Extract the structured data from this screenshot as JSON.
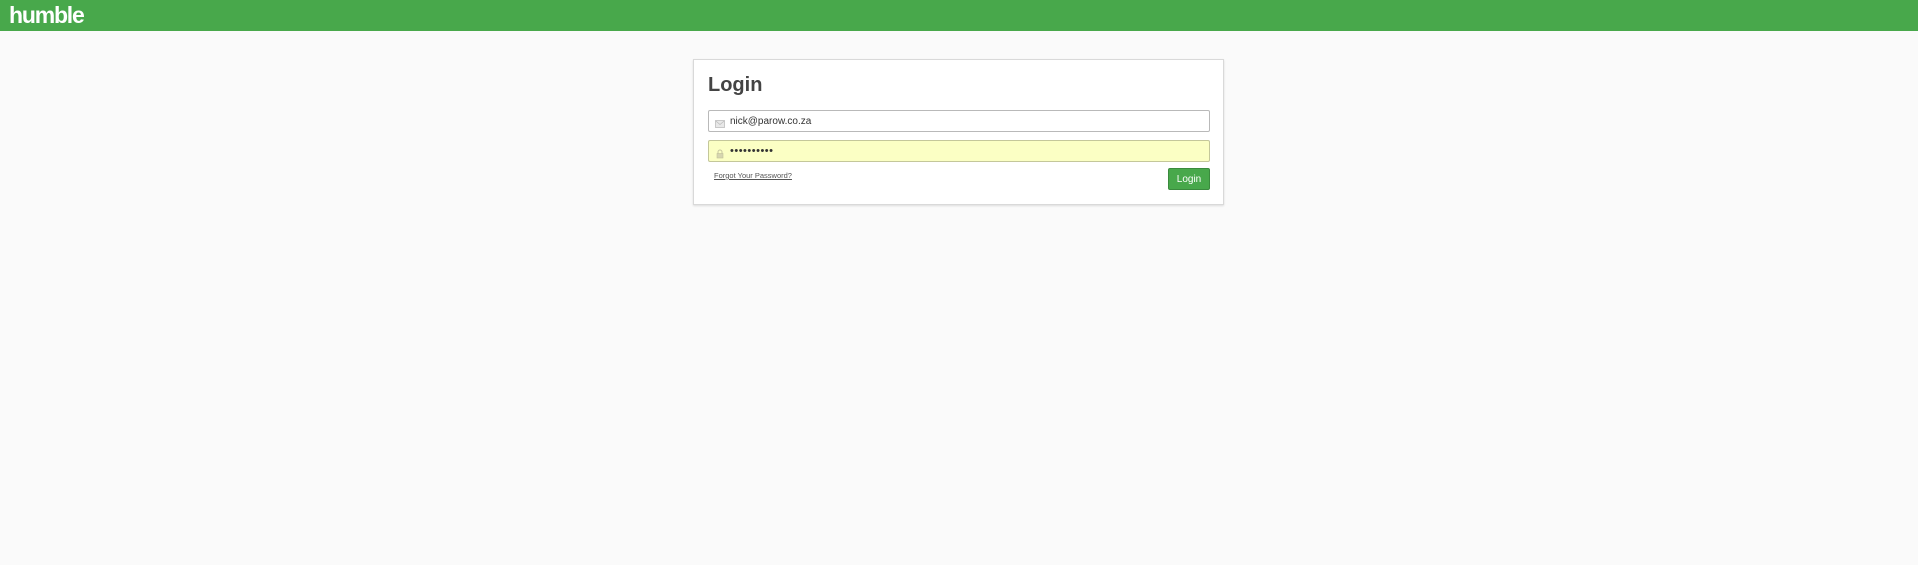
{
  "header": {
    "logo_text": "humble",
    "bar_color": "#48a84b"
  },
  "login_card": {
    "title": "Login",
    "email_field": {
      "icon": "envelope-icon",
      "value": "nick@parow.co.za"
    },
    "password_field": {
      "icon": "lock-icon",
      "value": "••••••••••"
    },
    "forgot_password_label": "Forgot Your Password?",
    "login_button_label": "Login",
    "button_color": "#48a84b"
  }
}
